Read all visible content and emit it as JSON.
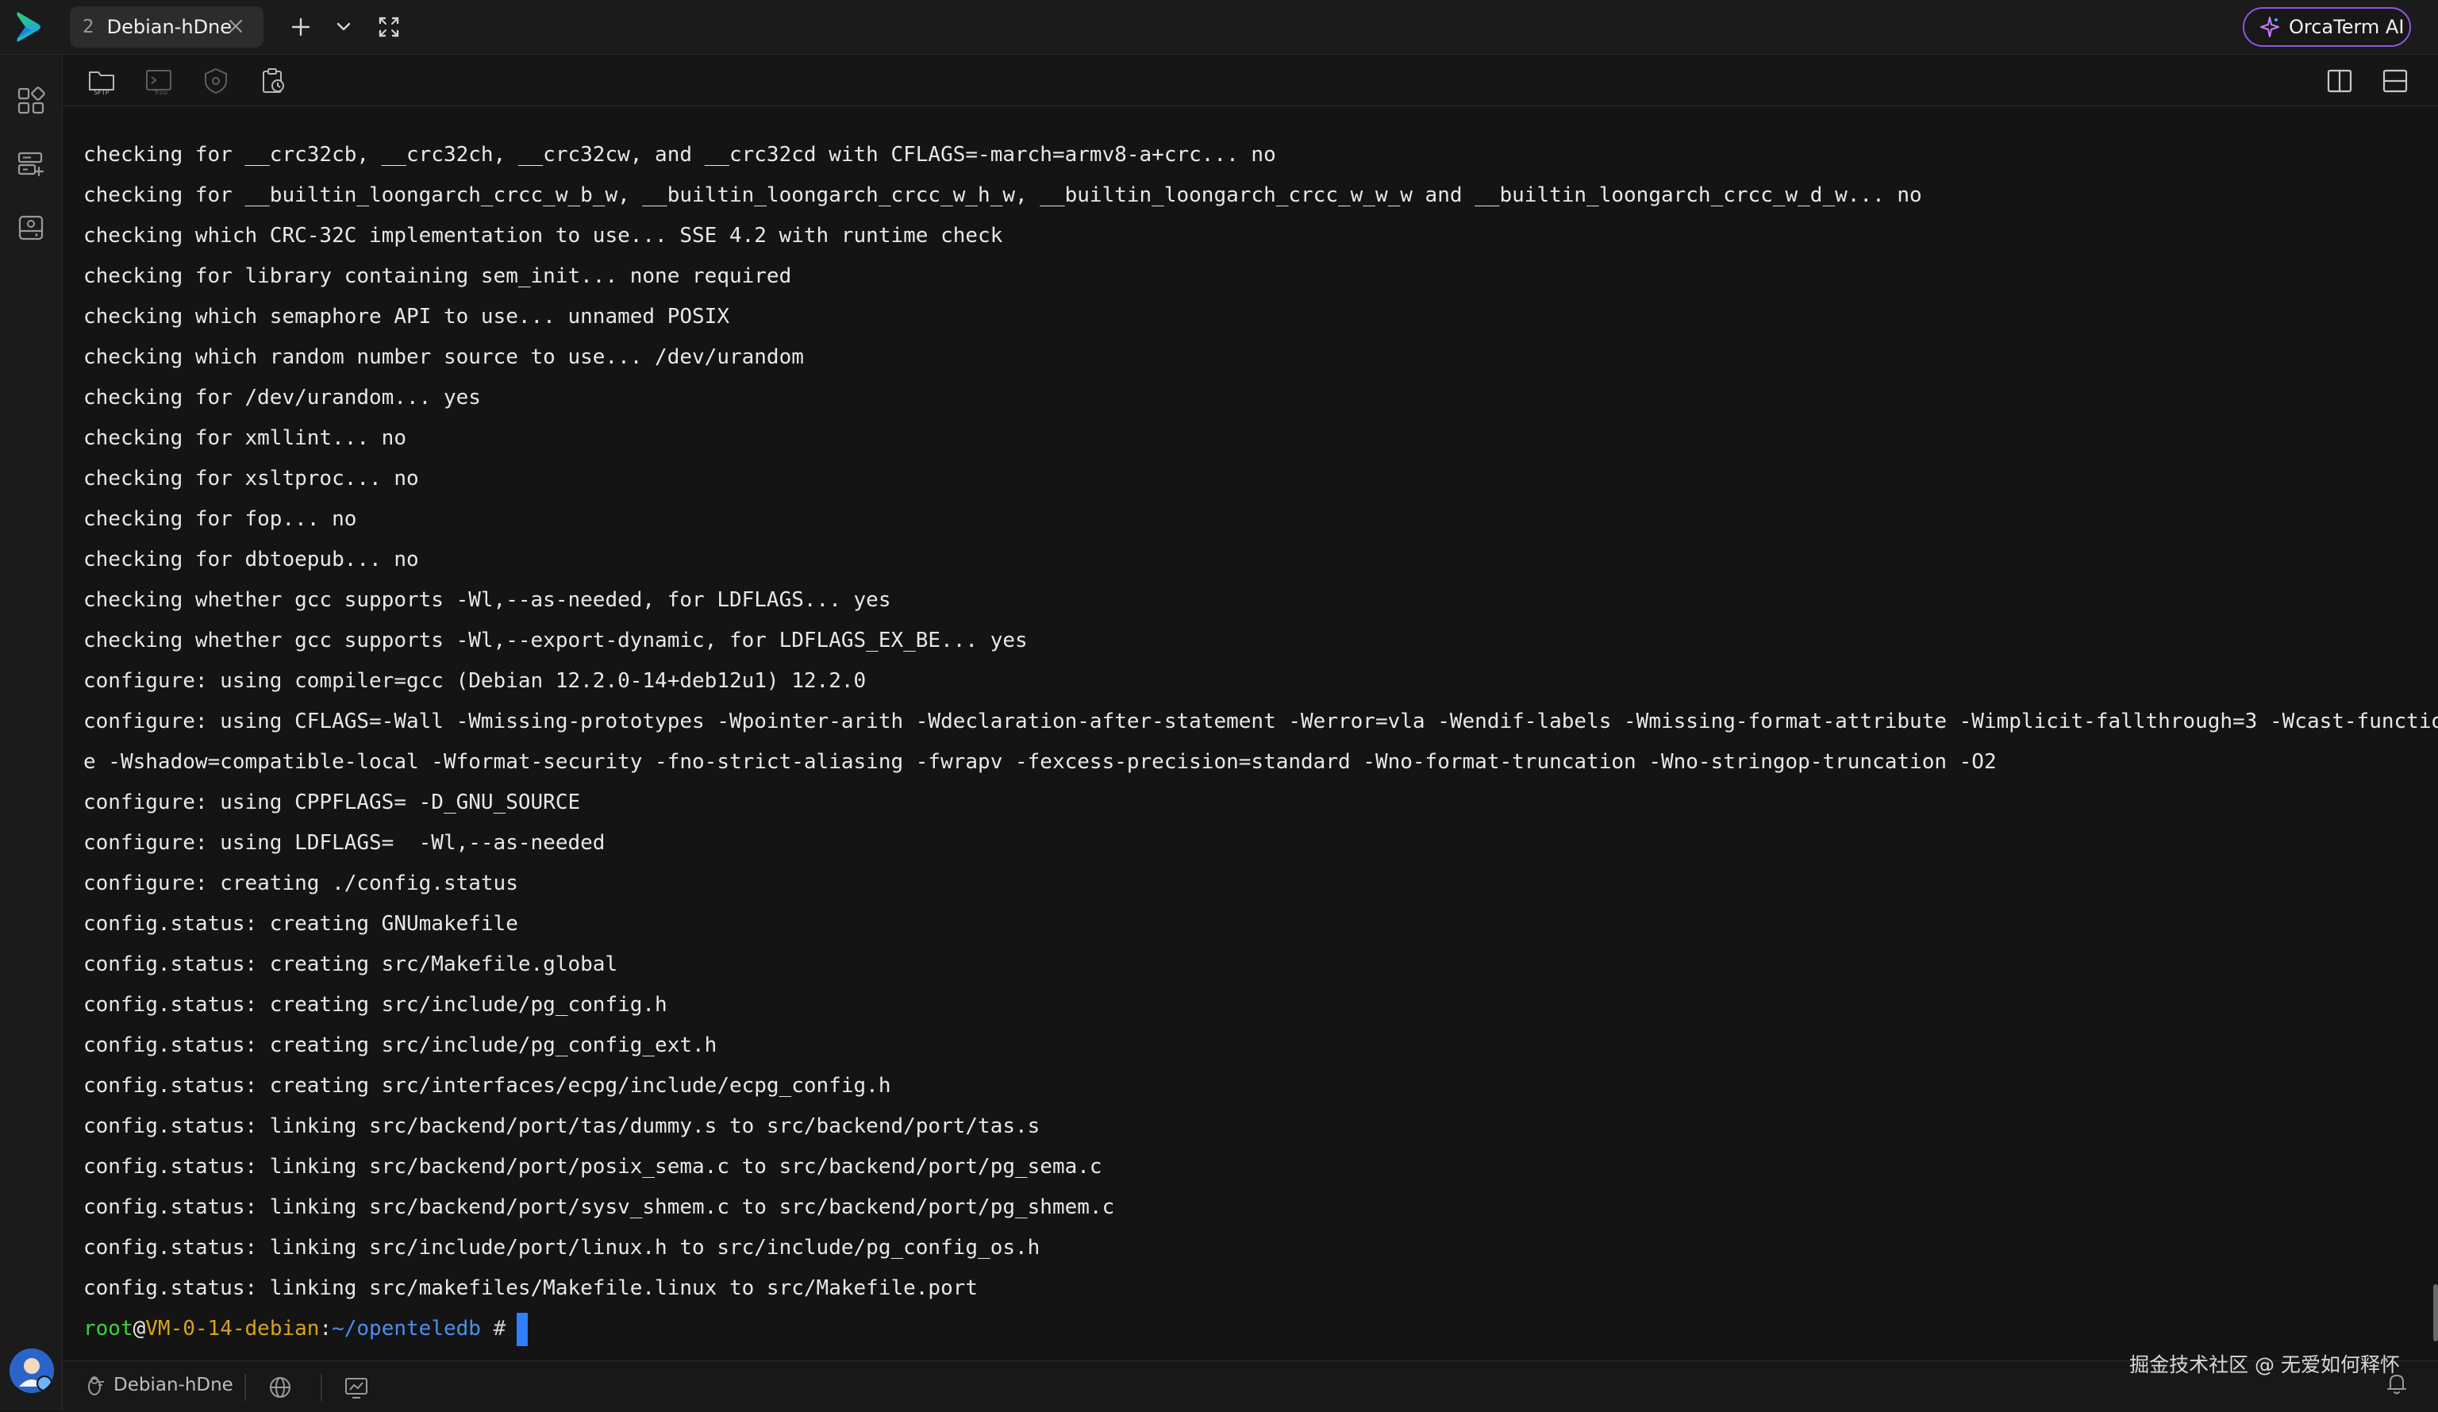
{
  "tabbar": {
    "tab": {
      "index": "2",
      "label": "Debian-hDne"
    },
    "ai_button_label": "OrcaTerm AI"
  },
  "sidebar": {
    "icons": [
      "apps-grid-icon",
      "server-list-icon",
      "drive-icon"
    ]
  },
  "toolbar": {
    "icons": [
      "sftp-folder-icon",
      "terminal-window-icon",
      "shield-icon",
      "clipboard-icon",
      "split-vertical-icon",
      "split-horizontal-icon"
    ]
  },
  "terminal": {
    "lines": [
      "checking for __crc32cb, __crc32ch, __crc32cw, and __crc32cd with CFLAGS=-march=armv8-a+crc... no",
      "checking for __builtin_loongarch_crcc_w_b_w, __builtin_loongarch_crcc_w_h_w, __builtin_loongarch_crcc_w_w_w and __builtin_loongarch_crcc_w_d_w... no",
      "checking which CRC-32C implementation to use... SSE 4.2 with runtime check",
      "checking for library containing sem_init... none required",
      "checking which semaphore API to use... unnamed POSIX",
      "checking which random number source to use... /dev/urandom",
      "checking for /dev/urandom... yes",
      "checking for xmllint... no",
      "checking for xsltproc... no",
      "checking for fop... no",
      "checking for dbtoepub... no",
      "checking whether gcc supports -Wl,--as-needed, for LDFLAGS... yes",
      "checking whether gcc supports -Wl,--export-dynamic, for LDFLAGS_EX_BE... yes",
      "configure: using compiler=gcc (Debian 12.2.0-14+deb12u1) 12.2.0",
      "configure: using CFLAGS=-Wall -Wmissing-prototypes -Wpointer-arith -Wdeclaration-after-statement -Werror=vla -Wendif-labels -Wmissing-format-attribute -Wimplicit-fallthrough=3 -Wcast-function-typ",
      "e -Wshadow=compatible-local -Wformat-security -fno-strict-aliasing -fwrapv -fexcess-precision=standard -Wno-format-truncation -Wno-stringop-truncation -O2",
      "configure: using CPPFLAGS= -D_GNU_SOURCE",
      "configure: using LDFLAGS=  -Wl,--as-needed",
      "configure: creating ./config.status",
      "config.status: creating GNUmakefile",
      "config.status: creating src/Makefile.global",
      "config.status: creating src/include/pg_config.h",
      "config.status: creating src/include/pg_config_ext.h",
      "config.status: creating src/interfaces/ecpg/include/ecpg_config.h",
      "config.status: linking src/backend/port/tas/dummy.s to src/backend/port/tas.s",
      "config.status: linking src/backend/port/posix_sema.c to src/backend/port/pg_sema.c",
      "config.status: linking src/backend/port/sysv_shmem.c to src/backend/port/pg_shmem.c",
      "config.status: linking src/include/port/linux.h to src/include/pg_config_os.h",
      "config.status: linking src/makefiles/Makefile.linux to src/Makefile.port"
    ],
    "prompt": {
      "user": "root",
      "at": "@",
      "host": "VM-0-14-debian",
      "colon": ":",
      "path": "~/openteledb",
      "symbol": " #"
    }
  },
  "statusbar": {
    "session_label": "Debian-hDne"
  },
  "watermark": "掘金技术社区 @ 无爱如何释怀",
  "colors": {
    "prompt_user": "#3fd13f",
    "prompt_host": "#d9a21a",
    "prompt_path": "#4a8ff0",
    "cursor": "#2f80ff",
    "ai_border": "#8e54e9"
  }
}
